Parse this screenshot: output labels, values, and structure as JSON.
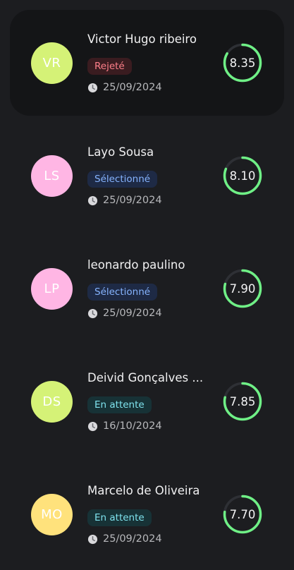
{
  "candidates": [
    {
      "initials": "VR",
      "name": "Victor Hugo ribeiro",
      "status": "Rejeté",
      "status_kind": "rejected",
      "date": "25/09/2024",
      "score": "8.35",
      "score_fraction": 0.835,
      "avatar_color": "#d5f277",
      "selected": true
    },
    {
      "initials": "LS",
      "name": "Layo Sousa",
      "status": "Sélectionné",
      "status_kind": "selected",
      "date": "25/09/2024",
      "score": "8.10",
      "score_fraction": 0.81,
      "avatar_color": "#ffb6e4",
      "selected": false
    },
    {
      "initials": "LP",
      "name": "leonardo paulino",
      "status": "Sélectionné",
      "status_kind": "selected",
      "date": "25/09/2024",
      "score": "7.90",
      "score_fraction": 0.79,
      "avatar_color": "#ffb6e4",
      "selected": false
    },
    {
      "initials": "DS",
      "name": "Deivid Gonçalves ...",
      "status": "En attente",
      "status_kind": "pending",
      "date": "16/10/2024",
      "score": "7.85",
      "score_fraction": 0.785,
      "avatar_color": "#d5f277",
      "selected": false
    },
    {
      "initials": "MO",
      "name": "Marcelo de Oliveira",
      "status": "En attente",
      "status_kind": "pending",
      "date": "25/09/2024",
      "score": "7.70",
      "score_fraction": 0.77,
      "avatar_color": "#ffe27c",
      "selected": false
    }
  ],
  "status_colors": {
    "rejected": {
      "bg": "#3a1c20",
      "fg": "#ff7f8a"
    },
    "selected": {
      "bg": "#1e2a45",
      "fg": "#86b4ff"
    },
    "pending": {
      "bg": "#173236",
      "fg": "#7fe3ee"
    }
  },
  "colors": {
    "ring_progress": "#6ff086",
    "ring_track": "#2e3035",
    "clock_icon": "clock-icon"
  }
}
